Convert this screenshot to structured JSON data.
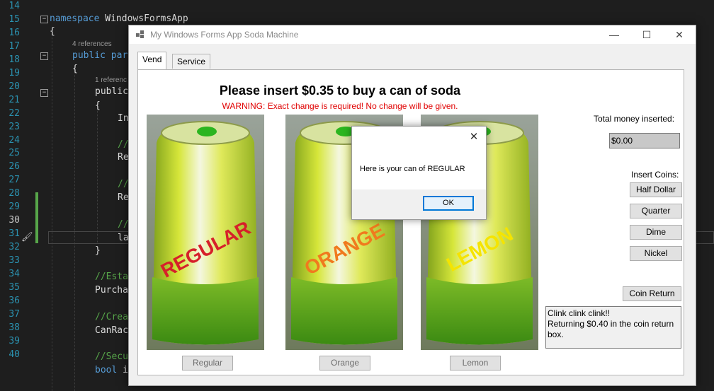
{
  "editor": {
    "line_numbers": [
      "14",
      "15",
      "16",
      "17",
      "18",
      "19",
      "20",
      "21",
      "22",
      "23",
      "24",
      "25",
      "26",
      "27",
      "28",
      "29",
      "30",
      "31",
      "32",
      "33",
      "34",
      "35",
      "36",
      "37",
      "38",
      "39",
      "40"
    ],
    "namespace_keyword": "namespace",
    "namespace_name": " WindowsFormsApp",
    "brace_open": "{",
    "refs_4": "4 references",
    "public_kw": "public",
    "public_par": " par",
    "refs_1": "1 referenc",
    "lines": {
      "l21": "In",
      "l23": "//",
      "l24": "Re",
      "l26": "//",
      "l27": "Re",
      "l29": "//",
      "l30": "la",
      "l31": "}",
      "l33": "//Esta",
      "l34": "Purcha",
      "l36": "//Crea",
      "l37": "CanRac",
      "l39": "//Secu",
      "l40_kw": "bool",
      "l40_rest": " i"
    }
  },
  "window": {
    "title": "My Windows Forms App Soda Machine",
    "minimize_glyph": "—",
    "maximize_glyph": "☐",
    "close_glyph": "✕",
    "tabs": [
      {
        "label": "Vend",
        "selected": true
      },
      {
        "label": "Service",
        "selected": false
      }
    ],
    "vend": {
      "headline": "Please insert $0.35 to buy a can of soda",
      "warning": "WARNING: Exact change is required! No change will be given.",
      "cans": [
        {
          "flavor_text": "REGULAR",
          "text_color": "#d6202a",
          "button": "Regular"
        },
        {
          "flavor_text": "ORANGE",
          "text_color": "#f07a1e",
          "button": "Orange"
        },
        {
          "flavor_text": "LEMON",
          "text_color": "#f5e400",
          "button": "Lemon"
        }
      ],
      "total_label": "Total money inserted:",
      "total_value": "$0.00",
      "insert_coins_label": "Insert Coins:",
      "coins": [
        "Half Dollar",
        "Quarter",
        "Dime",
        "Nickel"
      ],
      "coin_return": "Coin Return",
      "message_lines": [
        "Clink clink clink!!",
        "Returning $0.40 in the coin return box."
      ]
    }
  },
  "dialog": {
    "close_glyph": "✕",
    "message": "Here is your can of REGULAR",
    "ok_label": "OK"
  },
  "colors": {
    "editor_bg": "#1e1e1e",
    "keyword": "#569cd6",
    "comment": "#57a64a",
    "line_number": "#2b91af",
    "warning": "#e00000",
    "accent": "#0078d7"
  }
}
